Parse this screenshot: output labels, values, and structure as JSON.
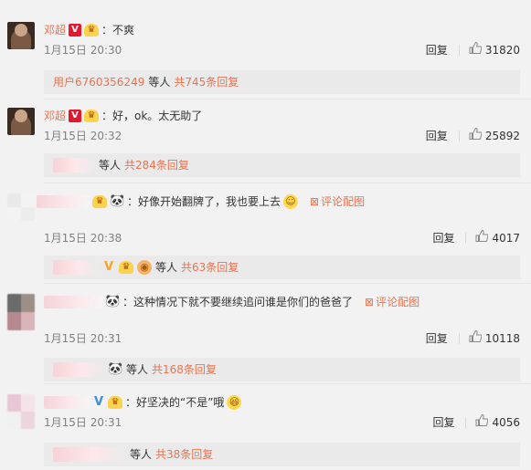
{
  "comments": [
    {
      "user": "邓超",
      "text": "：不爽",
      "time": "1月15日 20:30",
      "reply": "回复",
      "likes": "31820",
      "replies": {
        "user": "用户6760356249",
        "mid": "等人",
        "count": "共745条回复"
      }
    },
    {
      "user": "邓超",
      "text": "：好，ok。太无助了",
      "time": "1月15日 20:32",
      "reply": "回复",
      "likes": "25892",
      "replies": {
        "mid": "等人",
        "count": "共284条回复"
      }
    },
    {
      "text": "：好像开始翻牌了，我也要上去",
      "pic": "评论配图",
      "time": "1月15日 20:38",
      "reply": "回复",
      "likes": "4017",
      "replies": {
        "mid": "等人",
        "count": "共63条回复"
      }
    },
    {
      "text": "：这种情况下就不要继续追问谁是你们的爸爸了",
      "pic": "评论配图",
      "time": "1月15日 20:31",
      "reply": "回复",
      "likes": "10118",
      "replies": {
        "mid": "等人",
        "count": "共168条回复"
      }
    },
    {
      "text": "：好坚决的“不是”哦",
      "time": "1月15日 20:31",
      "reply": "回复",
      "likes": "4056",
      "replies": {
        "mid": "等人",
        "count": "共38条回复"
      }
    }
  ],
  "icons": {
    "verified": "V",
    "crown": "♛",
    "panda": "🐼",
    "like": "👍",
    "picture": "⊠",
    "laugh": "😆"
  },
  "colors": {
    "link": "#eb7350",
    "verified_red": "#e6162d",
    "background": "#f2f2f2"
  }
}
